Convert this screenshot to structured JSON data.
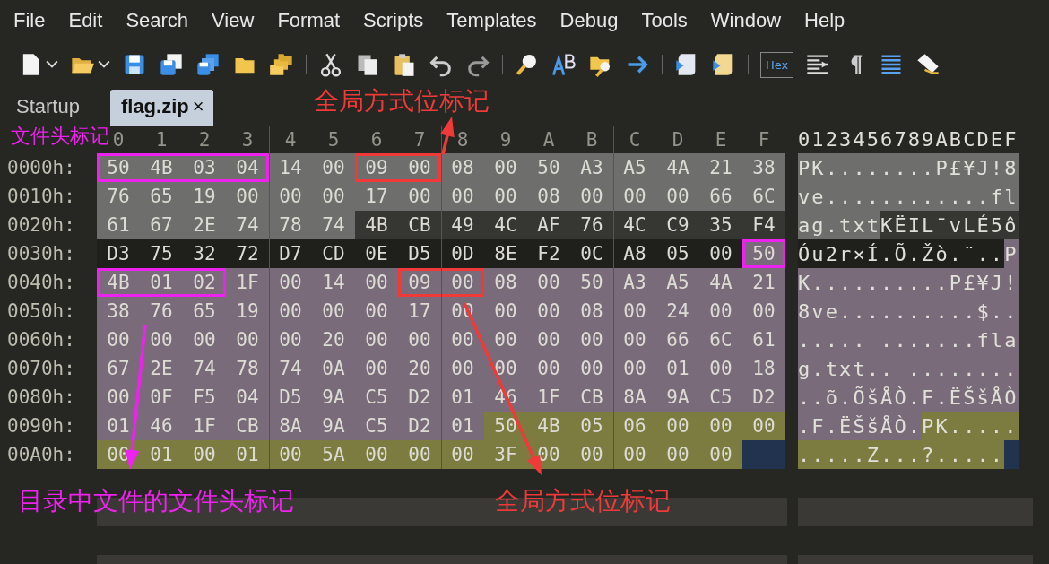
{
  "menu": [
    "File",
    "Edit",
    "Search",
    "View",
    "Format",
    "Scripts",
    "Templates",
    "Debug",
    "Tools",
    "Window",
    "Help"
  ],
  "toolbar": {
    "hex_label": "Hex"
  },
  "tabs": [
    {
      "label": "Startup",
      "selected": false
    },
    {
      "label": "flag.zip",
      "selected": true,
      "close": "×"
    }
  ],
  "hex_view": {
    "columns": [
      "0",
      "1",
      "2",
      "3",
      "4",
      "5",
      "6",
      "7",
      "8",
      "9",
      "A",
      "B",
      "C",
      "D",
      "E",
      "F"
    ],
    "ascii_header": "0123456789ABCDEF",
    "rows": [
      {
        "offset": "0000h:",
        "hex": [
          {
            "kind": "header",
            "color": "#ee22ee",
            "bytes": [
              "50",
              "4B",
              "03",
              "04"
            ]
          },
          {
            "kind": "header",
            "bytes": [
              "14",
              "00"
            ]
          },
          {
            "kind": "header",
            "color": "#f03a3a",
            "bytes": [
              "09",
              "00"
            ]
          },
          {
            "kind": "header",
            "bytes": [
              "08",
              "00",
              "50",
              "A3",
              "A5",
              "4A",
              "21",
              "38"
            ]
          }
        ],
        "ascii": [
          {
            "kind": "header",
            "text": "PK........P£¥J!8"
          }
        ]
      },
      {
        "offset": "0010h:",
        "hex": [
          {
            "kind": "header",
            "bytes": [
              "76",
              "65",
              "19",
              "00",
              "00",
              "00",
              "17",
              "00",
              "00",
              "00",
              "08",
              "00",
              "00",
              "00",
              "66",
              "6C"
            ]
          }
        ],
        "ascii": [
          {
            "kind": "header",
            "text": "ve............fl"
          }
        ]
      },
      {
        "offset": "0020h:",
        "hex": [
          {
            "kind": "header",
            "bytes": [
              "61",
              "67",
              "2E",
              "74",
              "78",
              "74"
            ]
          },
          {
            "kind": "data",
            "bytes": [
              "4B",
              "CB",
              "49",
              "4C",
              "AF",
              "76",
              "4C",
              "C9",
              "35",
              "F4"
            ]
          }
        ],
        "ascii": [
          {
            "kind": "header",
            "text": "ag.txt"
          },
          {
            "kind": "data",
            "text": "KËIL¯vLÉ5ô"
          }
        ]
      },
      {
        "offset": "0030h:",
        "hex": [
          {
            "kind": "data-alt",
            "bytes": [
              "D3",
              "75",
              "32",
              "72",
              "D7",
              "CD",
              "0E",
              "D5",
              "0D",
              "8E",
              "F2",
              "0C",
              "A8",
              "05",
              "00"
            ]
          },
          {
            "kind": "central",
            "color": "#ee22ee",
            "bytes": [
              "50"
            ]
          }
        ],
        "ascii": [
          {
            "kind": "data-alt",
            "text": "Óu2r×Í.Õ.Žò.¨.."
          },
          {
            "kind": "central",
            "text": "P"
          }
        ]
      },
      {
        "offset": "0040h:",
        "hex": [
          {
            "kind": "central",
            "color": "#ee22ee",
            "bytes": [
              "4B",
              "01",
              "02"
            ]
          },
          {
            "kind": "central",
            "bytes": [
              "1F",
              "00",
              "14",
              "00"
            ]
          },
          {
            "kind": "central",
            "color": "#f03a3a",
            "bytes": [
              "09",
              "00"
            ]
          },
          {
            "kind": "central",
            "bytes": [
              "08",
              "00",
              "50",
              "A3",
              "A5",
              "4A",
              "21"
            ]
          }
        ],
        "ascii": [
          {
            "kind": "central",
            "text": "K..........P£¥J!"
          }
        ]
      },
      {
        "offset": "0050h:",
        "hex": [
          {
            "kind": "central",
            "bytes": [
              "38",
              "76",
              "65",
              "19",
              "00",
              "00",
              "00",
              "17",
              "00",
              "00",
              "00",
              "08",
              "00",
              "24",
              "00",
              "00"
            ]
          }
        ],
        "ascii": [
          {
            "kind": "central",
            "text": "8ve..........$.."
          }
        ]
      },
      {
        "offset": "0060h:",
        "hex": [
          {
            "kind": "central",
            "bytes": [
              "00",
              "00",
              "00",
              "00",
              "00",
              "20",
              "00",
              "00",
              "00",
              "00",
              "00",
              "00",
              "00",
              "66",
              "6C",
              "61"
            ]
          }
        ],
        "ascii": [
          {
            "kind": "central",
            "text": "..... .......fla"
          }
        ]
      },
      {
        "offset": "0070h:",
        "hex": [
          {
            "kind": "central",
            "bytes": [
              "67",
              "2E",
              "74",
              "78",
              "74",
              "0A",
              "00",
              "20",
              "00",
              "00",
              "00",
              "00",
              "00",
              "01",
              "00",
              "18"
            ]
          }
        ],
        "ascii": [
          {
            "kind": "central",
            "text": "g.txt.. ........"
          }
        ]
      },
      {
        "offset": "0080h:",
        "hex": [
          {
            "kind": "central",
            "bytes": [
              "00",
              "0F",
              "F5",
              "04",
              "D5",
              "9A",
              "C5",
              "D2",
              "01",
              "46",
              "1F",
              "CB",
              "8A",
              "9A",
              "C5",
              "D2"
            ]
          }
        ],
        "ascii": [
          {
            "kind": "central",
            "text": "..õ.ÕšÅÒ.F.ËŠšÅÒ"
          }
        ]
      },
      {
        "offset": "0090h:",
        "hex": [
          {
            "kind": "central",
            "bytes": [
              "01",
              "46",
              "1F",
              "CB",
              "8A",
              "9A",
              "C5",
              "D2",
              "01"
            ]
          },
          {
            "kind": "end",
            "bytes": [
              "50",
              "4B",
              "05",
              "06",
              "00",
              "00",
              "00"
            ]
          }
        ],
        "ascii": [
          {
            "kind": "central",
            "text": ".F.ËŠšÅÒ."
          },
          {
            "kind": "end",
            "text": "PK....."
          }
        ]
      },
      {
        "offset": "00A0h:",
        "cursor": true,
        "hex": [
          {
            "kind": "end",
            "bytes": [
              "00",
              "01",
              "00",
              "01",
              "00",
              "5A",
              "00",
              "00",
              "00",
              "3F",
              "00",
              "00",
              "00",
              "00",
              "00"
            ]
          }
        ],
        "ascii": [
          {
            "kind": "end",
            "text": ".....Z...?....."
          }
        ]
      }
    ]
  },
  "annotations": [
    {
      "text": "全局方式位标记",
      "color": "#f03a3a",
      "arrow": true
    },
    {
      "text": "文件头标记",
      "color": "#ee22ee",
      "arrow": false
    },
    {
      "text": "目录中文件的文件头标记",
      "color": "#ee22ee",
      "arrow": true
    },
    {
      "text": "全局方式位标记",
      "color": "#f03a3a",
      "arrow": true
    }
  ]
}
